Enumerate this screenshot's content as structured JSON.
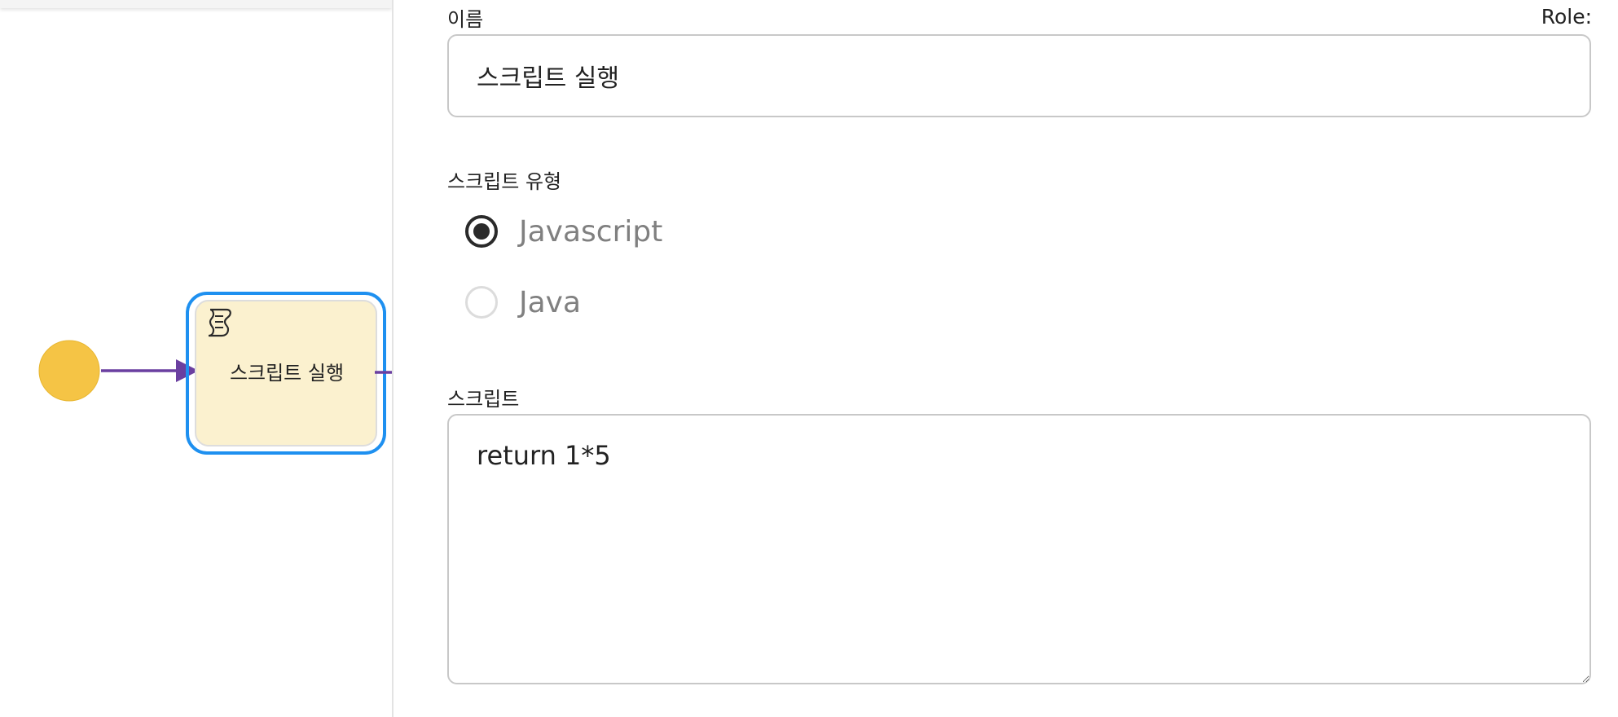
{
  "canvas": {
    "task_label": "스크립트 실행",
    "colors": {
      "start_event": "#F5C445",
      "flow_arrow": "#6A3FA0",
      "task_fill": "#FBF1CF",
      "selection": "#1E90F0"
    },
    "icons": {
      "task_type": "script-icon"
    }
  },
  "panel": {
    "role_label": "Role:",
    "name": {
      "label": "이름",
      "value": "스크립트 실행"
    },
    "script_type": {
      "label": "스크립트 유형",
      "options": [
        {
          "label": "Javascript",
          "checked": true
        },
        {
          "label": "Java",
          "checked": false
        }
      ]
    },
    "script": {
      "label": "스크립트",
      "value": "return 1*5"
    }
  }
}
